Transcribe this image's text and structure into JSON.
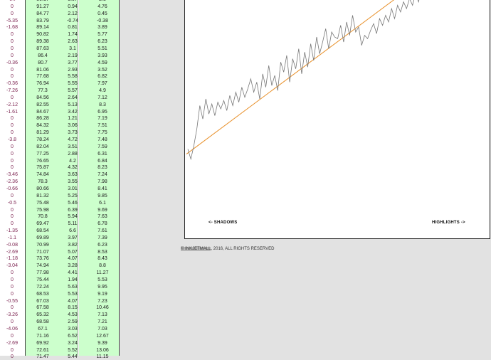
{
  "table": {
    "rows": [
      {
        "a": "-0.7",
        "b": "80.17",
        "c": "3.07",
        "d": "2.3"
      },
      {
        "a": "0",
        "b": "91.27",
        "c": "0.94",
        "d": "4.76"
      },
      {
        "a": "0",
        "b": "84.77",
        "c": "2.12",
        "d": "0.45"
      },
      {
        "a": "-5.35",
        "b": "83.79",
        "c": "-0.74",
        "d": "-0.38"
      },
      {
        "a": "-1.68",
        "b": "89.14",
        "c": "0.81",
        "d": "3.89"
      },
      {
        "a": "0",
        "b": "90.82",
        "c": "1.74",
        "d": "5.77"
      },
      {
        "a": "0",
        "b": "89.38",
        "c": "2.63",
        "d": "6.23"
      },
      {
        "a": "0",
        "b": "87.63",
        "c": "3.1",
        "d": "5.51"
      },
      {
        "a": "0",
        "b": "86.4",
        "c": "2.19",
        "d": "3.93"
      },
      {
        "a": "-0.36",
        "b": "80.7",
        "c": "3.77",
        "d": "4.59"
      },
      {
        "a": "0",
        "b": "81.06",
        "c": "2.93",
        "d": "3.52"
      },
      {
        "a": "0",
        "b": "77.68",
        "c": "5.58",
        "d": "6.82"
      },
      {
        "a": "-0.36",
        "b": "76.94",
        "c": "5.55",
        "d": "7.97"
      },
      {
        "a": "-7.26",
        "b": "77.3",
        "c": "5.57",
        "d": "4.9"
      },
      {
        "a": "0",
        "b": "84.56",
        "c": "2.64",
        "d": "7.12"
      },
      {
        "a": "-2.12",
        "b": "82.55",
        "c": "5.13",
        "d": "8.3"
      },
      {
        "a": "-1.61",
        "b": "84.67",
        "c": "3.42",
        "d": "6.95"
      },
      {
        "a": "0",
        "b": "86.28",
        "c": "1.21",
        "d": "7.19"
      },
      {
        "a": "0",
        "b": "84.32",
        "c": "3.06",
        "d": "7.51"
      },
      {
        "a": "0",
        "b": "81.29",
        "c": "3.73",
        "d": "7.75"
      },
      {
        "a": "-3.8",
        "b": "78.24",
        "c": "4.72",
        "d": "7.48"
      },
      {
        "a": "0",
        "b": "82.04",
        "c": "3.51",
        "d": "7.59"
      },
      {
        "a": "0",
        "b": "77.25",
        "c": "2.88",
        "d": "6.31"
      },
      {
        "a": "0",
        "b": "76.65",
        "c": "4.2",
        "d": "6.84"
      },
      {
        "a": "0",
        "b": "75.87",
        "c": "4.32",
        "d": "8.23"
      },
      {
        "a": "-3.46",
        "b": "74.84",
        "c": "3.63",
        "d": "7.24"
      },
      {
        "a": "-2.36",
        "b": "78.3",
        "c": "3.55",
        "d": "7.98"
      },
      {
        "a": "-0.66",
        "b": "80.66",
        "c": "3.01",
        "d": "8.41"
      },
      {
        "a": "0",
        "b": "81.32",
        "c": "5.25",
        "d": "9.85"
      },
      {
        "a": "-0.5",
        "b": "75.48",
        "c": "5.46",
        "d": "6.1"
      },
      {
        "a": "0",
        "b": "75.98",
        "c": "6.39",
        "d": "9.69"
      },
      {
        "a": "0",
        "b": "70.8",
        "c": "5.94",
        "d": "7.63"
      },
      {
        "a": "0",
        "b": "69.47",
        "c": "5.11",
        "d": "6.78"
      },
      {
        "a": "-1.35",
        "b": "68.54",
        "c": "6.6",
        "d": "7.61"
      },
      {
        "a": "-1.1",
        "b": "69.89",
        "c": "3.97",
        "d": "7.39"
      },
      {
        "a": "-0.08",
        "b": "70.99",
        "c": "3.82",
        "d": "6.23"
      },
      {
        "a": "-2.69",
        "b": "71.07",
        "c": "5.07",
        "d": "8.53"
      },
      {
        "a": "-1.18",
        "b": "73.76",
        "c": "4.07",
        "d": "8.43"
      },
      {
        "a": "-3.04",
        "b": "74.94",
        "c": "3.28",
        "d": "8.8"
      },
      {
        "a": "0",
        "b": "77.98",
        "c": "4.41",
        "d": "11.27"
      },
      {
        "a": "0",
        "b": "75.44",
        "c": "1.94",
        "d": "5.53"
      },
      {
        "a": "0",
        "b": "72.24",
        "c": "5.63",
        "d": "9.95"
      },
      {
        "a": "0",
        "b": "68.53",
        "c": "5.53",
        "d": "9.19"
      },
      {
        "a": "-0.55",
        "b": "67.03",
        "c": "4.07",
        "d": "7.23"
      },
      {
        "a": "0",
        "b": "67.58",
        "c": "8.15",
        "d": "10.46"
      },
      {
        "a": "-3.26",
        "b": "65.32",
        "c": "4.53",
        "d": "7.13"
      },
      {
        "a": "0",
        "b": "68.58",
        "c": "2.59",
        "d": "7.21"
      },
      {
        "a": "-4.06",
        "b": "67.1",
        "c": "3.03",
        "d": "7.03"
      },
      {
        "a": "0",
        "b": "71.16",
        "c": "6.52",
        "d": "12.67"
      },
      {
        "a": "-2.69",
        "b": "69.92",
        "c": "3.24",
        "d": "9.39"
      },
      {
        "a": "0",
        "b": "72.61",
        "c": "5.52",
        "d": "13.06"
      },
      {
        "a": "0",
        "b": "71.47",
        "c": "5.44",
        "d": "11.15"
      }
    ]
  },
  "chart": {
    "label_left": "<- SHADOWS",
    "label_right": "HIGHLIGHTS ->",
    "trend_color": "#e8902a",
    "line_color": "#777777"
  },
  "chart_data": {
    "type": "line",
    "series": [
      {
        "values": [
          0.1,
          0.04,
          0.12,
          0.22,
          0.36,
          0.28,
          0.4,
          0.31,
          0.37,
          0.3,
          0.38,
          0.34,
          0.39,
          0.33,
          0.42,
          0.36,
          0.44,
          0.38,
          0.47,
          0.41,
          0.46,
          0.52,
          0.44,
          0.5,
          0.4,
          0.55,
          0.47,
          0.6,
          0.48,
          0.54,
          0.45,
          0.62,
          0.56,
          0.66,
          0.5,
          0.64,
          0.58,
          0.7,
          0.55,
          0.68,
          0.59,
          0.73,
          0.63,
          0.77,
          0.67,
          0.74,
          0.82,
          0.7,
          0.8,
          0.77,
          0.76,
          0.84,
          0.74,
          0.86,
          0.78,
          0.9,
          0.8,
          0.83,
          0.72,
          0.78,
          0.76,
          0.81,
          0.85,
          0.79,
          0.88,
          0.84,
          0.9,
          0.86,
          0.94,
          0.88,
          0.96,
          0.92,
          0.98,
          0.94,
          1.0,
          0.96,
          1.03,
          0.98,
          1.06,
          1.0,
          1.08,
          1.04
        ]
      },
      {
        "values": [
          0.07,
          1.07
        ]
      }
    ]
  },
  "copyright": {
    "highlight": "© INKJETMALL",
    "rest": ", 2016, ALL RIGHTS RESERVED"
  }
}
